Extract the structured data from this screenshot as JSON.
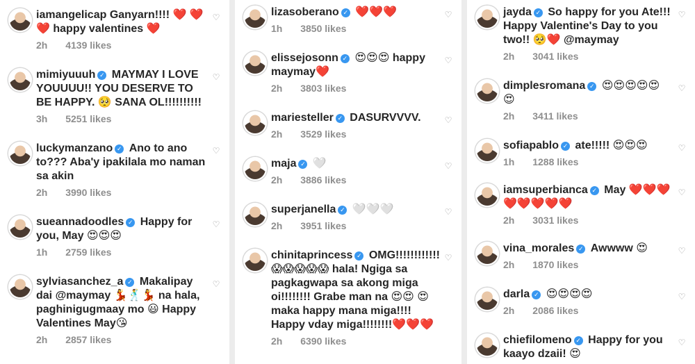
{
  "columns": [
    {
      "comments": [
        {
          "username": "iamangelicap",
          "verified": false,
          "text": "Ganyarn!!!! ❤️ ❤️❤️ happy valentines ❤️",
          "time": "2h",
          "likes": "4139 likes"
        },
        {
          "username": "mimiyuuuh",
          "verified": true,
          "text": "MAYMAY I LOVE YOUUUU!! YOU DESERVE TO BE HAPPY. 🥺 SANA OL!!!!!!!!!!",
          "time": "3h",
          "likes": "5251 likes"
        },
        {
          "username": "luckymanzano",
          "verified": true,
          "text": "Ano to ano to??? Aba'y ipakilala mo naman sa akin",
          "time": "2h",
          "likes": "3990 likes"
        },
        {
          "username": "sueannadoodles",
          "verified": true,
          "text": "Happy for you, May 😍😍😍",
          "time": "1h",
          "likes": "2759 likes"
        },
        {
          "username": "sylviasanchez_a",
          "verified": true,
          "text": "Makalipay dai @maymay 💃🕺💃 na hala, paghinigugmaay mo 😃 Happy Valentines May😘",
          "time": "2h",
          "likes": "2857 likes"
        }
      ]
    },
    {
      "comments": [
        {
          "username": "lizasoberano",
          "verified": true,
          "text": "❤️❤️❤️",
          "time": "1h",
          "likes": "3850 likes"
        },
        {
          "username": "elissejosonn",
          "verified": true,
          "text": "😍😍😍 happy maymay❤️",
          "time": "2h",
          "likes": "3803 likes"
        },
        {
          "username": "mariesteller",
          "verified": true,
          "text": "DASURVVVV.",
          "time": "2h",
          "likes": "3529 likes"
        },
        {
          "username": "maja",
          "verified": true,
          "text": "🤍",
          "time": "2h",
          "likes": "3886 likes"
        },
        {
          "username": "superjanella",
          "verified": true,
          "text": "🤍🤍🤍",
          "time": "2h",
          "likes": "3951 likes"
        },
        {
          "username": "chinitaprincess",
          "verified": true,
          "text": "OMG!!!!!!!!!!!! 😱😱😱😱😱 hala! Ngiga sa pagkagwapa sa akong miga oi!!!!!!!! Grabe man na 😍😍 😍 maka happy mana miga!!!! Happy vday miga!!!!!!!!❤️❤️❤️",
          "time": "2h",
          "likes": "6390 likes"
        }
      ]
    },
    {
      "comments": [
        {
          "username": "jayda",
          "verified": true,
          "text": "So happy for you Ate!!! Happy Valentine's Day to you two!! 🥺❤️ @maymay",
          "time": "2h",
          "likes": "3041 likes"
        },
        {
          "username": "dimplesromana",
          "verified": true,
          "text": "😍😍😍😍😍 😍",
          "time": "2h",
          "likes": "3411 likes"
        },
        {
          "username": "sofiapablo",
          "verified": true,
          "text": "ate!!!!! 😍😍😍",
          "time": "1h",
          "likes": "1288 likes"
        },
        {
          "username": "iamsuperbianca",
          "verified": true,
          "text": "May ❤️❤️❤️ ❤️❤️❤️❤️❤️",
          "time": "2h",
          "likes": "3031 likes"
        },
        {
          "username": "vina_morales",
          "verified": true,
          "text": "Awwww 😍",
          "time": "2h",
          "likes": "1870 likes"
        },
        {
          "username": "darla",
          "verified": true,
          "text": "😍😍😍😍",
          "time": "2h",
          "likes": "2086 likes"
        },
        {
          "username": "chiefilomeno",
          "verified": true,
          "text": "Happy for you kaayo dzaii! 😍",
          "time": "",
          "likes": ""
        }
      ]
    }
  ],
  "icons": {
    "like": "heart-outline-icon",
    "verified": "verified-badge-icon"
  },
  "colors": {
    "verified": "#3897f0",
    "meta": "#8e8e8e",
    "mention": "#00376b",
    "background": "#ffffff"
  }
}
